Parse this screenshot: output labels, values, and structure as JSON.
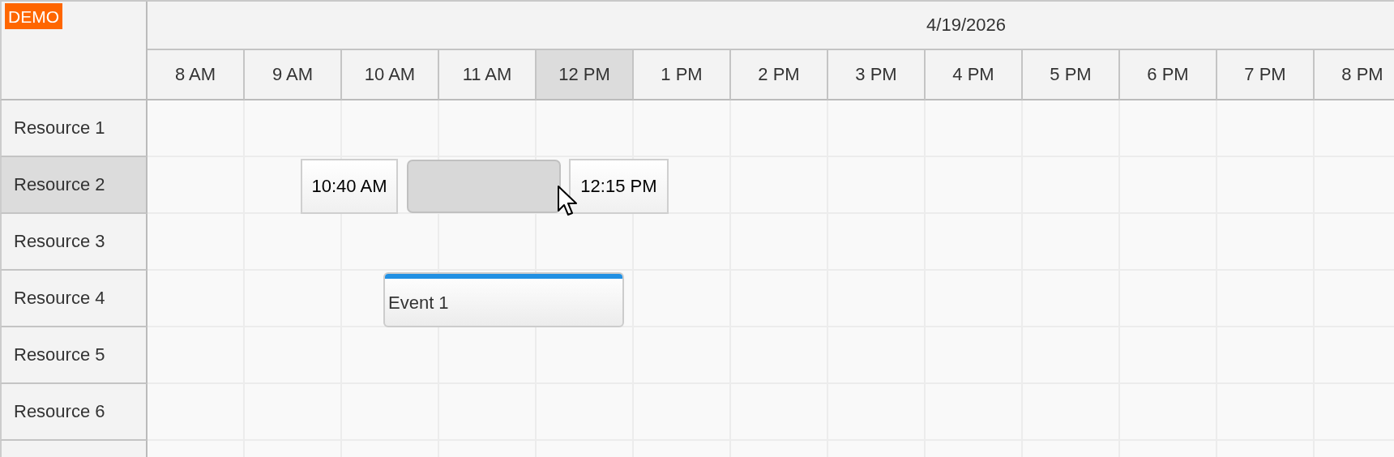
{
  "badge": "DEMO",
  "date": "4/19/2026",
  "hours": [
    {
      "label": "8 AM",
      "selected": false
    },
    {
      "label": "9 AM",
      "selected": false
    },
    {
      "label": "10 AM",
      "selected": false
    },
    {
      "label": "11 AM",
      "selected": false
    },
    {
      "label": "12 PM",
      "selected": true
    },
    {
      "label": "1 PM",
      "selected": false
    },
    {
      "label": "2 PM",
      "selected": false
    },
    {
      "label": "3 PM",
      "selected": false
    },
    {
      "label": "4 PM",
      "selected": false
    },
    {
      "label": "5 PM",
      "selected": false
    },
    {
      "label": "6 PM",
      "selected": false
    },
    {
      "label": "7 PM",
      "selected": false
    },
    {
      "label": "8 PM",
      "selected": false
    }
  ],
  "resources": [
    {
      "name": "Resource 1",
      "selected": false
    },
    {
      "name": "Resource 2",
      "selected": true,
      "selection": {
        "start_label": "10:40 AM",
        "end_label": "12:15 PM"
      }
    },
    {
      "name": "Resource 3",
      "selected": false
    },
    {
      "name": "Resource 4",
      "selected": false,
      "events": [
        {
          "text": "Event 1",
          "color": "#2190e3"
        }
      ]
    },
    {
      "name": "Resource 5",
      "selected": false
    },
    {
      "name": "Resource 6",
      "selected": false
    },
    {
      "selected": false
    }
  ]
}
